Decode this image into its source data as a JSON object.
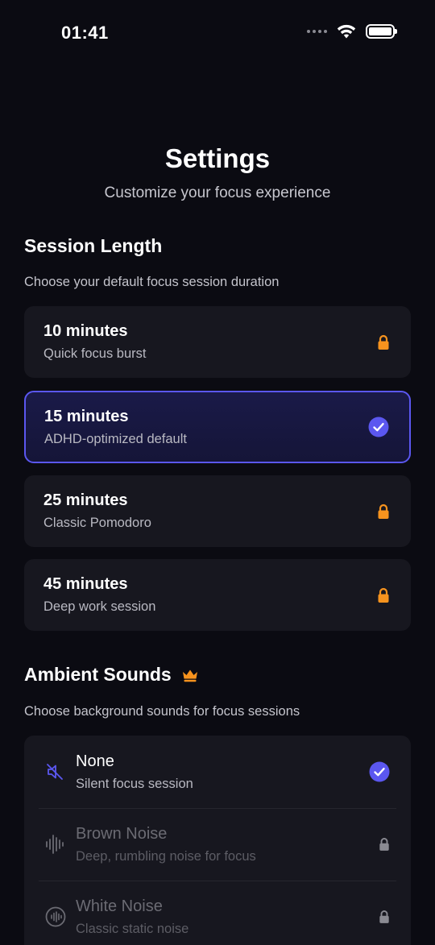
{
  "status_bar": {
    "time": "01:41"
  },
  "header": {
    "title": "Settings",
    "subtitle": "Customize your focus experience"
  },
  "session_length": {
    "title": "Session Length",
    "description": "Choose your default focus session duration",
    "options": [
      {
        "label": "10 minutes",
        "sublabel": "Quick focus burst",
        "state": "locked"
      },
      {
        "label": "15 minutes",
        "sublabel": "ADHD-optimized default",
        "state": "selected"
      },
      {
        "label": "25 minutes",
        "sublabel": "Classic Pomodoro",
        "state": "locked"
      },
      {
        "label": "45 minutes",
        "sublabel": "Deep work session",
        "state": "locked"
      }
    ]
  },
  "ambient_sounds": {
    "title": "Ambient Sounds",
    "premium_icon": "crown-icon",
    "description": "Choose background sounds for focus sessions",
    "options": [
      {
        "label": "None",
        "sublabel": "Silent focus session",
        "icon": "speaker-muted-icon",
        "state": "selected"
      },
      {
        "label": "Brown Noise",
        "sublabel": "Deep, rumbling noise for focus",
        "icon": "waveform-icon",
        "state": "locked"
      },
      {
        "label": "White Noise",
        "sublabel": "Classic static noise",
        "icon": "waveform-circle-icon",
        "state": "locked"
      }
    ]
  },
  "colors": {
    "background": "#0b0b12",
    "card": "#17171f",
    "accent": "#5b57f0",
    "lock_orange": "#f7931e",
    "lock_gray": "#8a8a92"
  }
}
